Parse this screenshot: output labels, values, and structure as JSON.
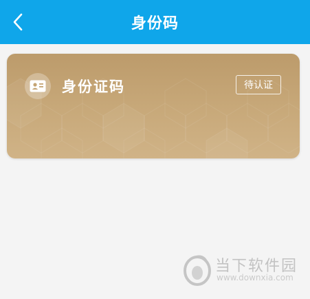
{
  "header": {
    "title": "身份码",
    "back_icon": "chevron-left-icon",
    "background_color": "#0fa6ea"
  },
  "card": {
    "icon": "id-card-icon",
    "title": "身份证码",
    "status": "待认证",
    "background_color": "#c4a473"
  },
  "watermark": {
    "name": "当下软件园",
    "url": "www.downxia.com"
  }
}
